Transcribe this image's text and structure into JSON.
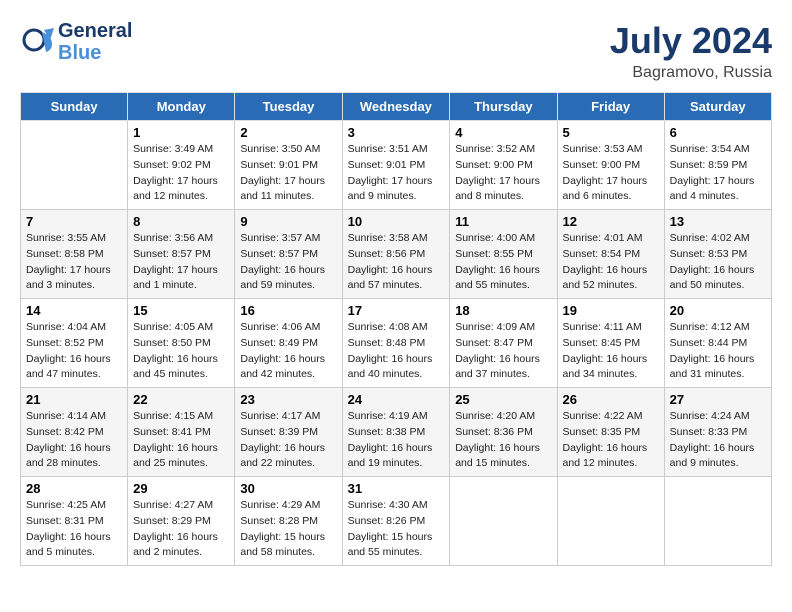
{
  "header": {
    "logo_line1": "General",
    "logo_line2": "Blue",
    "title": "July 2024",
    "location": "Bagramovo, Russia"
  },
  "weekdays": [
    "Sunday",
    "Monday",
    "Tuesday",
    "Wednesday",
    "Thursday",
    "Friday",
    "Saturday"
  ],
  "weeks": [
    [
      {
        "day": "",
        "info": ""
      },
      {
        "day": "1",
        "info": "Sunrise: 3:49 AM\nSunset: 9:02 PM\nDaylight: 17 hours\nand 12 minutes."
      },
      {
        "day": "2",
        "info": "Sunrise: 3:50 AM\nSunset: 9:01 PM\nDaylight: 17 hours\nand 11 minutes."
      },
      {
        "day": "3",
        "info": "Sunrise: 3:51 AM\nSunset: 9:01 PM\nDaylight: 17 hours\nand 9 minutes."
      },
      {
        "day": "4",
        "info": "Sunrise: 3:52 AM\nSunset: 9:00 PM\nDaylight: 17 hours\nand 8 minutes."
      },
      {
        "day": "5",
        "info": "Sunrise: 3:53 AM\nSunset: 9:00 PM\nDaylight: 17 hours\nand 6 minutes."
      },
      {
        "day": "6",
        "info": "Sunrise: 3:54 AM\nSunset: 8:59 PM\nDaylight: 17 hours\nand 4 minutes."
      }
    ],
    [
      {
        "day": "7",
        "info": "Sunrise: 3:55 AM\nSunset: 8:58 PM\nDaylight: 17 hours\nand 3 minutes."
      },
      {
        "day": "8",
        "info": "Sunrise: 3:56 AM\nSunset: 8:57 PM\nDaylight: 17 hours\nand 1 minute."
      },
      {
        "day": "9",
        "info": "Sunrise: 3:57 AM\nSunset: 8:57 PM\nDaylight: 16 hours\nand 59 minutes."
      },
      {
        "day": "10",
        "info": "Sunrise: 3:58 AM\nSunset: 8:56 PM\nDaylight: 16 hours\nand 57 minutes."
      },
      {
        "day": "11",
        "info": "Sunrise: 4:00 AM\nSunset: 8:55 PM\nDaylight: 16 hours\nand 55 minutes."
      },
      {
        "day": "12",
        "info": "Sunrise: 4:01 AM\nSunset: 8:54 PM\nDaylight: 16 hours\nand 52 minutes."
      },
      {
        "day": "13",
        "info": "Sunrise: 4:02 AM\nSunset: 8:53 PM\nDaylight: 16 hours\nand 50 minutes."
      }
    ],
    [
      {
        "day": "14",
        "info": "Sunrise: 4:04 AM\nSunset: 8:52 PM\nDaylight: 16 hours\nand 47 minutes."
      },
      {
        "day": "15",
        "info": "Sunrise: 4:05 AM\nSunset: 8:50 PM\nDaylight: 16 hours\nand 45 minutes."
      },
      {
        "day": "16",
        "info": "Sunrise: 4:06 AM\nSunset: 8:49 PM\nDaylight: 16 hours\nand 42 minutes."
      },
      {
        "day": "17",
        "info": "Sunrise: 4:08 AM\nSunset: 8:48 PM\nDaylight: 16 hours\nand 40 minutes."
      },
      {
        "day": "18",
        "info": "Sunrise: 4:09 AM\nSunset: 8:47 PM\nDaylight: 16 hours\nand 37 minutes."
      },
      {
        "day": "19",
        "info": "Sunrise: 4:11 AM\nSunset: 8:45 PM\nDaylight: 16 hours\nand 34 minutes."
      },
      {
        "day": "20",
        "info": "Sunrise: 4:12 AM\nSunset: 8:44 PM\nDaylight: 16 hours\nand 31 minutes."
      }
    ],
    [
      {
        "day": "21",
        "info": "Sunrise: 4:14 AM\nSunset: 8:42 PM\nDaylight: 16 hours\nand 28 minutes."
      },
      {
        "day": "22",
        "info": "Sunrise: 4:15 AM\nSunset: 8:41 PM\nDaylight: 16 hours\nand 25 minutes."
      },
      {
        "day": "23",
        "info": "Sunrise: 4:17 AM\nSunset: 8:39 PM\nDaylight: 16 hours\nand 22 minutes."
      },
      {
        "day": "24",
        "info": "Sunrise: 4:19 AM\nSunset: 8:38 PM\nDaylight: 16 hours\nand 19 minutes."
      },
      {
        "day": "25",
        "info": "Sunrise: 4:20 AM\nSunset: 8:36 PM\nDaylight: 16 hours\nand 15 minutes."
      },
      {
        "day": "26",
        "info": "Sunrise: 4:22 AM\nSunset: 8:35 PM\nDaylight: 16 hours\nand 12 minutes."
      },
      {
        "day": "27",
        "info": "Sunrise: 4:24 AM\nSunset: 8:33 PM\nDaylight: 16 hours\nand 9 minutes."
      }
    ],
    [
      {
        "day": "28",
        "info": "Sunrise: 4:25 AM\nSunset: 8:31 PM\nDaylight: 16 hours\nand 5 minutes."
      },
      {
        "day": "29",
        "info": "Sunrise: 4:27 AM\nSunset: 8:29 PM\nDaylight: 16 hours\nand 2 minutes."
      },
      {
        "day": "30",
        "info": "Sunrise: 4:29 AM\nSunset: 8:28 PM\nDaylight: 15 hours\nand 58 minutes."
      },
      {
        "day": "31",
        "info": "Sunrise: 4:30 AM\nSunset: 8:26 PM\nDaylight: 15 hours\nand 55 minutes."
      },
      {
        "day": "",
        "info": ""
      },
      {
        "day": "",
        "info": ""
      },
      {
        "day": "",
        "info": ""
      }
    ]
  ]
}
